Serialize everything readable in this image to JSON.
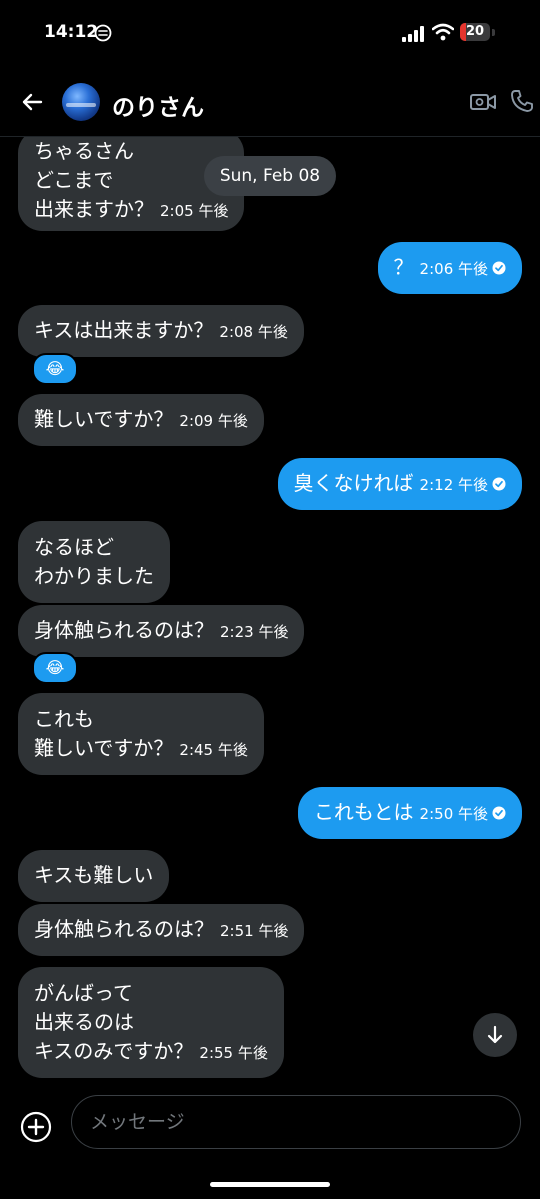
{
  "status_bar": {
    "time": "14:12",
    "battery": "20",
    "battery_fraction": 0.2
  },
  "header": {
    "contact_name": "のりさん"
  },
  "date_divider": "Sun, Feb 08",
  "messages": [
    {
      "lines": [
        "ちゃるさん",
        "どこまで",
        "出来ますか？"
      ],
      "time": "2:05 午後"
    },
    {
      "lines": [
        "？"
      ],
      "time": "2:06 午後"
    },
    {
      "lines": [
        "キスは出来ますか？"
      ],
      "time": "2:08 午後"
    },
    {
      "lines": [
        "難しいですか？"
      ],
      "time": "2:09 午後"
    },
    {
      "lines": [
        "臭くなければ"
      ],
      "time": "2:12 午後"
    },
    {
      "lines": [
        "なるほど",
        "わかりました"
      ]
    },
    {
      "lines": [
        "身体触られるのは？"
      ],
      "time": "2:23 午後"
    },
    {
      "lines": [
        "これも",
        "難しいですか？"
      ],
      "time": "2:45 午後"
    },
    {
      "lines": [
        "これもとは"
      ],
      "time": "2:50 午後"
    },
    {
      "lines": [
        "キスも難しい"
      ]
    },
    {
      "lines": [
        "身体触られるのは？"
      ],
      "time": "2:51 午後"
    },
    {
      "lines": [
        "がんばって",
        "出来るのは",
        "キスのみですか？"
      ],
      "time": "2:55 午後"
    }
  ],
  "reactions": [
    "😂",
    "😂"
  ],
  "composer": {
    "placeholder": "メッセージ"
  },
  "colors": {
    "outgoing": "#1d9bf0",
    "incoming": "#2f3336",
    "background": "#000000"
  }
}
